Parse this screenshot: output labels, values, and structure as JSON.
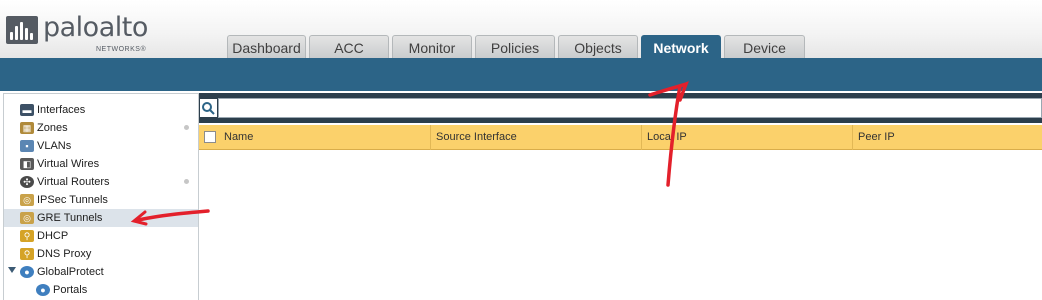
{
  "brand": {
    "name": "paloalto",
    "subtitle": "NETWORKS®"
  },
  "tabs": [
    {
      "label": "Dashboard",
      "active": false
    },
    {
      "label": "ACC",
      "active": false
    },
    {
      "label": "Monitor",
      "active": false
    },
    {
      "label": "Policies",
      "active": false
    },
    {
      "label": "Objects",
      "active": false
    },
    {
      "label": "Network",
      "active": true
    },
    {
      "label": "Device",
      "active": false
    }
  ],
  "sidebar": {
    "items": [
      {
        "label": "Interfaces",
        "icon": "interfaces-icon"
      },
      {
        "label": "Zones",
        "icon": "zones-icon"
      },
      {
        "label": "VLANs",
        "icon": "vlans-icon"
      },
      {
        "label": "Virtual Wires",
        "icon": "virtual-wires-icon"
      },
      {
        "label": "Virtual Routers",
        "icon": "virtual-routers-icon"
      },
      {
        "label": "IPSec Tunnels",
        "icon": "ipsec-tunnels-icon"
      },
      {
        "label": "GRE Tunnels",
        "icon": "gre-tunnels-icon",
        "selected": true
      },
      {
        "label": "DHCP",
        "icon": "dhcp-icon"
      },
      {
        "label": "DNS Proxy",
        "icon": "dns-proxy-icon"
      },
      {
        "label": "GlobalProtect",
        "icon": "globalprotect-icon",
        "expanded": true
      },
      {
        "label": "Portals",
        "icon": "portals-icon"
      }
    ]
  },
  "search": {
    "value": "",
    "icon": "search-icon"
  },
  "table": {
    "columns": [
      "Name",
      "Source Interface",
      "Local IP",
      "Peer IP"
    ],
    "rows": []
  },
  "colors": {
    "accent": "#2c6487",
    "header_row": "#fbd16b",
    "annotation": "#e3202b"
  }
}
